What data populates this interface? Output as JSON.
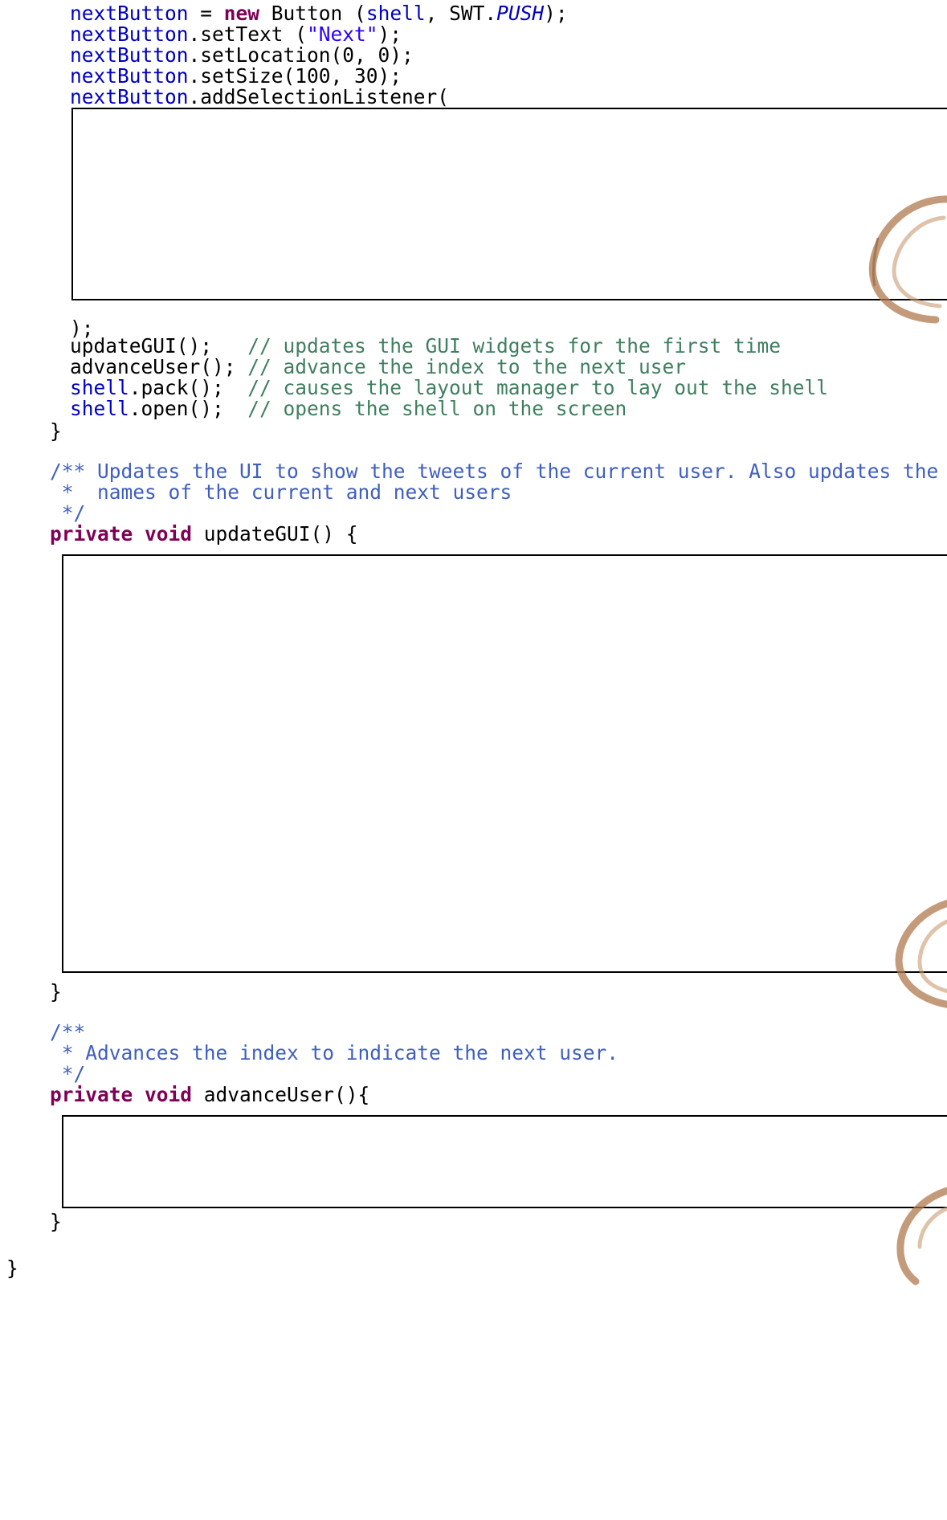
{
  "code": {
    "l1": {
      "a": "nextButton",
      "b": " = ",
      "c": "new",
      "d": " Button (",
      "e": "shell",
      "f": ", SWT.",
      "g": "PUSH",
      "h": ");"
    },
    "l2": {
      "a": "nextButton",
      "b": ".setText (",
      "c": "\"Next\"",
      "d": ");"
    },
    "l3": {
      "a": "nextButton",
      "b": ".setLocation(0, 0);"
    },
    "l4": {
      "a": "nextButton",
      "b": ".setSize(100, 30);"
    },
    "l5": {
      "a": "nextButton",
      "b": ".addSelectionListener("
    },
    "l6": {
      "a": ");"
    },
    "l7": {
      "a": "updateGUI();   ",
      "b": "// updates the GUI widgets for the first time"
    },
    "l8": {
      "a": "advanceUser(); ",
      "b": "// advance the index to the next user"
    },
    "l9": {
      "a": "shell",
      "b": ".pack();  ",
      "c": "// causes the layout manager to lay out the shell"
    },
    "l10": {
      "a": "shell",
      "b": ".open();  ",
      "c": "// opens the shell on the screen"
    },
    "l11": {
      "a": "}"
    },
    "l12": {
      "a": "/** Updates the UI to show the tweets of the current user. Also updates the"
    },
    "l13": {
      "a": " *  names of the current and next users"
    },
    "l14": {
      "a": " */"
    },
    "l15": {
      "a": "private",
      "b": " ",
      "c": "void",
      "d": " updateGUI() {"
    },
    "l16": {
      "a": "}"
    },
    "l17": {
      "a": "/**"
    },
    "l18": {
      "a": " * Advances the index to indicate the next user."
    },
    "l19": {
      "a": " */"
    },
    "l20": {
      "a": "private",
      "b": " ",
      "c": "void",
      "d": " advanceUser(){"
    },
    "l21": {
      "a": "}"
    },
    "l22": {
      "a": "}"
    }
  }
}
